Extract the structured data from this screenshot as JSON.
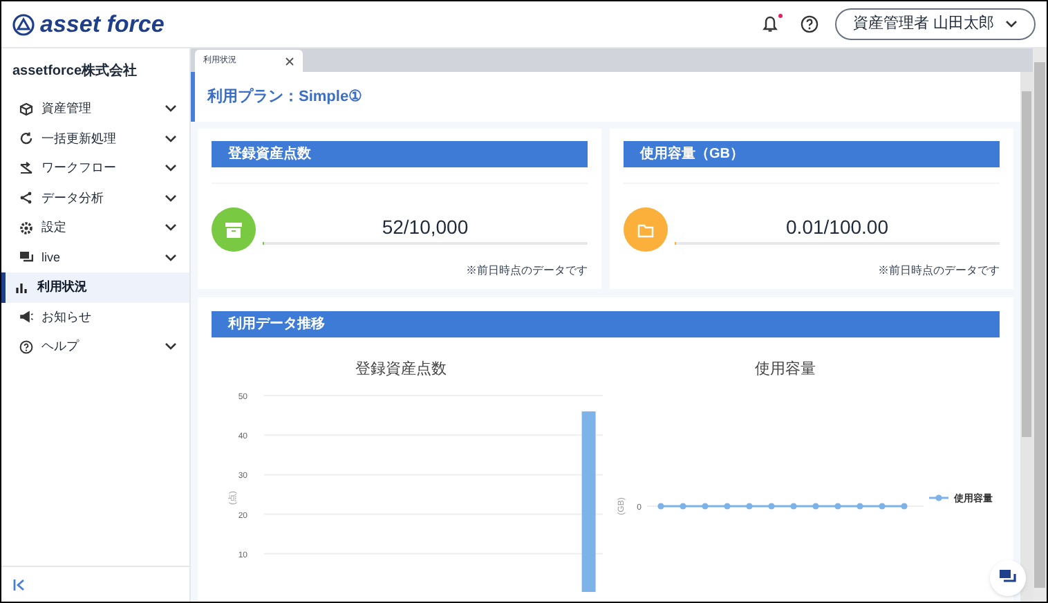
{
  "header": {
    "logo": "asset force",
    "notification": {
      "unread": true
    },
    "user_menu": "資産管理者 山田太郎"
  },
  "sidebar": {
    "company": "assetforce株式会社",
    "items": [
      {
        "label": "資産管理",
        "expandable": true,
        "selected": false
      },
      {
        "label": "一括更新処理",
        "expandable": true,
        "selected": false
      },
      {
        "label": "ワークフロー",
        "expandable": true,
        "selected": false
      },
      {
        "label": "データ分析",
        "expandable": true,
        "selected": false
      },
      {
        "label": "設定",
        "expandable": true,
        "selected": false
      },
      {
        "label": "live",
        "expandable": true,
        "selected": false
      },
      {
        "label": "利用状況",
        "expandable": false,
        "selected": true
      },
      {
        "label": "お知らせ",
        "expandable": false,
        "selected": false
      },
      {
        "label": "ヘルプ",
        "expandable": true,
        "selected": false
      }
    ]
  },
  "tabs": [
    {
      "label": "利用状況",
      "selected": true
    }
  ],
  "plan": "利用プラン：Simple①",
  "usage_cards": [
    {
      "title": "登録資産点数",
      "color": "#7ac943",
      "value": "52/10,000",
      "level": 0.0052,
      "note": "※前日時点のデータです"
    },
    {
      "title": "使用容量（GB）",
      "color": "#fbb03b",
      "value": "0.01/100.00",
      "level": 0.0001,
      "note": "※前日時点のデータです"
    }
  ],
  "trend": {
    "title": "利用データ推移",
    "charts": [
      {
        "kind": "bar",
        "chart_data": {
          "type": "bar",
          "title": "登録資産点数",
          "ylabel": "(点)",
          "series": [
            {
              "color": "#7db3e8",
              "values": [
                0,
                0,
                0,
                0,
                0,
                0,
                0,
                0,
                0,
                0,
                0,
                46
              ]
            }
          ],
          "ylim": [
            0,
            50
          ],
          "yticks": [
            10,
            20,
            30,
            40,
            50
          ],
          "grid": true
        }
      },
      {
        "kind": "line",
        "title": "使用容量",
        "ylabel": "(GB)",
        "tick": "0",
        "legend": "使用容量"
      }
    ]
  }
}
